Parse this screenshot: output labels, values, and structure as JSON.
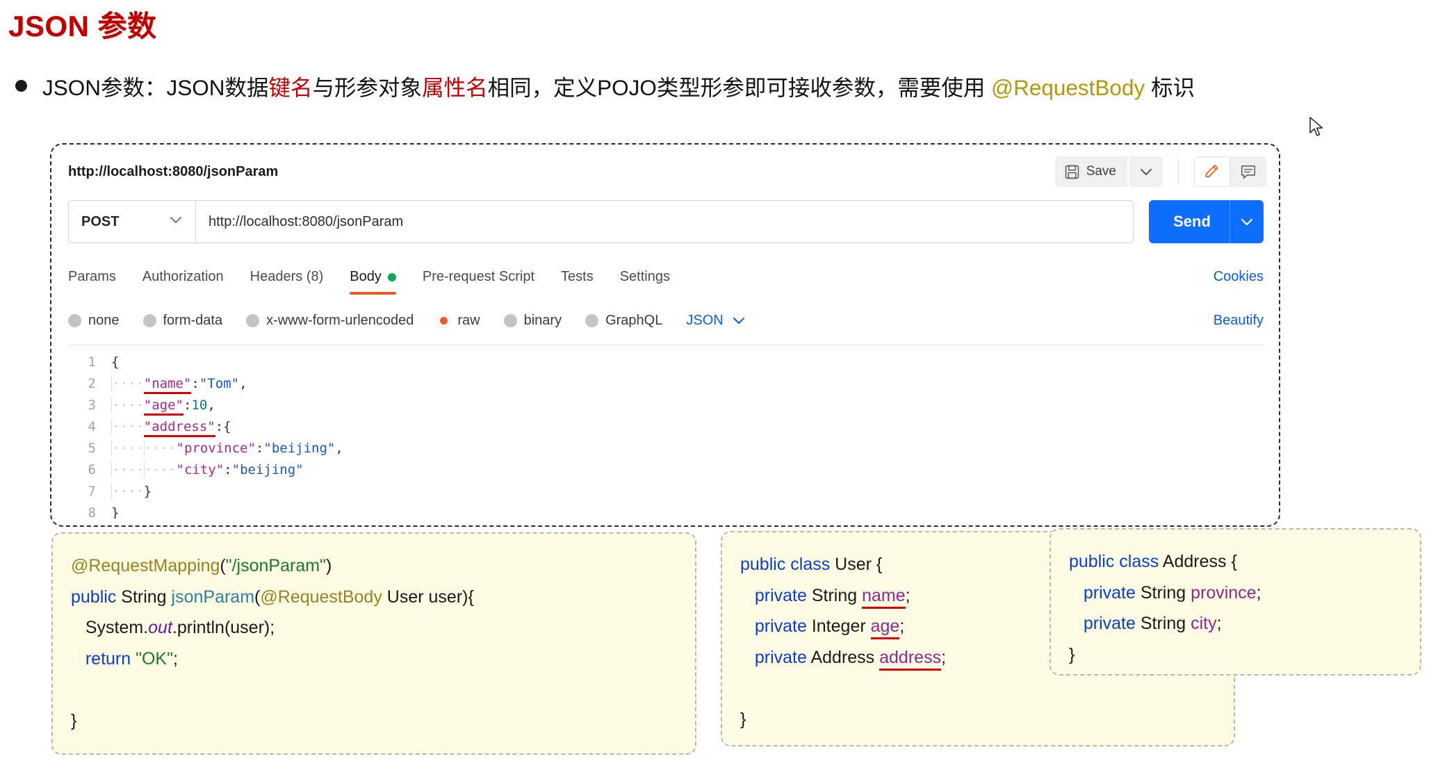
{
  "slide": {
    "title": "JSON 参数",
    "bullet": {
      "seg1": "JSON参数：JSON数据",
      "seg2_red": "键名",
      "seg3": "与形参对象",
      "seg4_red": "属性名",
      "seg5": "相同，定义POJO类型形参即可接收参数，需要使用 ",
      "seg6_gold": "@RequestBody",
      "seg7": " 标识"
    },
    "title_color": "#c00000",
    "highlight_color": "#c00000",
    "annotation_color": "#b8960b"
  },
  "postman": {
    "tab_title": "http://localhost:8080/jsonParam",
    "save_label": "Save",
    "icons": {
      "floppy": "save-icon",
      "caret": "chevron-down-icon",
      "pencil": "edit-pencil-icon",
      "comment": "comment-icon"
    },
    "method": "POST",
    "url": "http://localhost:8080/jsonParam",
    "send_label": "Send",
    "send_color": "#0d6efd",
    "tabs": [
      {
        "label": "Params",
        "active": false,
        "dot": false
      },
      {
        "label": "Authorization",
        "active": false,
        "dot": false
      },
      {
        "label": "Headers (8)",
        "active": false,
        "dot": false
      },
      {
        "label": "Body",
        "active": true,
        "dot": true
      },
      {
        "label": "Pre-request Script",
        "active": false,
        "dot": false
      },
      {
        "label": "Tests",
        "active": false,
        "dot": false
      },
      {
        "label": "Settings",
        "active": false,
        "dot": false
      }
    ],
    "cookies_label": "Cookies",
    "body_types": [
      {
        "label": "none",
        "selected": false
      },
      {
        "label": "form-data",
        "selected": false
      },
      {
        "label": "x-www-form-urlencoded",
        "selected": false
      },
      {
        "label": "raw",
        "selected": true
      },
      {
        "label": "binary",
        "selected": false
      },
      {
        "label": "GraphQL",
        "selected": false
      }
    ],
    "raw_format": "JSON",
    "beautify_label": "Beautify",
    "active_tab_underline_color": "#ef5b25",
    "body_dot_color": "#0ca750",
    "editor": {
      "lines": [
        {
          "n": "1",
          "indent": 0,
          "guides": 0,
          "tokens": [
            {
              "t": "{",
              "c": "pun"
            }
          ]
        },
        {
          "n": "2",
          "indent": 1,
          "guides": 1,
          "tokens": [
            {
              "t": "\"name\"",
              "c": "key",
              "ul": true
            },
            {
              "t": ":",
              "c": "pun"
            },
            {
              "t": "\"Tom\"",
              "c": "str"
            },
            {
              "t": ",",
              "c": "pun"
            }
          ]
        },
        {
          "n": "3",
          "indent": 1,
          "guides": 1,
          "tokens": [
            {
              "t": "\"age\"",
              "c": "key",
              "ul": true
            },
            {
              "t": ":",
              "c": "pun"
            },
            {
              "t": "10",
              "c": "num"
            },
            {
              "t": ",",
              "c": "pun"
            }
          ]
        },
        {
          "n": "4",
          "indent": 1,
          "guides": 1,
          "tokens": [
            {
              "t": "\"address\"",
              "c": "key",
              "ul": true
            },
            {
              "t": ":",
              "c": "pun"
            },
            {
              "t": "{",
              "c": "pun"
            }
          ]
        },
        {
          "n": "5",
          "indent": 2,
          "guides": 2,
          "tokens": [
            {
              "t": "\"province\"",
              "c": "key"
            },
            {
              "t": ":",
              "c": "pun"
            },
            {
              "t": "\"beijing\"",
              "c": "str"
            },
            {
              "t": ",",
              "c": "pun"
            }
          ]
        },
        {
          "n": "6",
          "indent": 2,
          "guides": 2,
          "tokens": [
            {
              "t": "\"city\"",
              "c": "key"
            },
            {
              "t": ":",
              "c": "pun"
            },
            {
              "t": "\"beijing\"",
              "c": "str"
            }
          ]
        },
        {
          "n": "7",
          "indent": 1,
          "guides": 1,
          "tokens": [
            {
              "t": "}",
              "c": "pun"
            }
          ]
        },
        {
          "n": "8",
          "indent": 0,
          "guides": 0,
          "tokens": [
            {
              "t": "}",
              "c": "pun"
            }
          ]
        }
      ]
    }
  },
  "code_cards": {
    "controller": {
      "lines": [
        [
          {
            "t": "@RequestMapping",
            "c": "ann"
          },
          {
            "t": "(",
            "c": "plain"
          },
          {
            "t": "\"/jsonParam\"",
            "c": "str"
          },
          {
            "t": ")",
            "c": "plain"
          }
        ],
        [
          {
            "t": "public",
            "c": "kw"
          },
          {
            "t": " String ",
            "c": "plain"
          },
          {
            "t": "jsonParam",
            "c": "meth"
          },
          {
            "t": "(",
            "c": "plain"
          },
          {
            "t": "@RequestBody",
            "c": "ann"
          },
          {
            "t": " User user){",
            "c": "plain"
          }
        ],
        [
          {
            "t": "   System.",
            "c": "plain"
          },
          {
            "t": "out",
            "c": "stat"
          },
          {
            "t": ".println(user);",
            "c": "plain"
          }
        ],
        [
          {
            "t": "   ",
            "c": "plain"
          },
          {
            "t": "return",
            "c": "kw"
          },
          {
            "t": " ",
            "c": "plain"
          },
          {
            "t": "\"OK\"",
            "c": "str"
          },
          {
            "t": ";",
            "c": "plain"
          }
        ],
        [],
        [
          {
            "t": "}",
            "c": "plain"
          }
        ]
      ]
    },
    "user_class": {
      "lines": [
        [
          {
            "t": "public class",
            "c": "kw"
          },
          {
            "t": " User {",
            "c": "plain"
          }
        ],
        [
          {
            "t": "   ",
            "c": "plain"
          },
          {
            "t": "private",
            "c": "kw"
          },
          {
            "t": " String ",
            "c": "plain"
          },
          {
            "t": "name",
            "c": "field",
            "ul": true
          },
          {
            "t": ";",
            "c": "plain"
          }
        ],
        [
          {
            "t": "   ",
            "c": "plain"
          },
          {
            "t": "private",
            "c": "kw"
          },
          {
            "t": " Integer ",
            "c": "plain"
          },
          {
            "t": "age",
            "c": "field",
            "ul": true
          },
          {
            "t": ";",
            "c": "plain"
          }
        ],
        [
          {
            "t": "   ",
            "c": "plain"
          },
          {
            "t": "private",
            "c": "kw"
          },
          {
            "t": " Address ",
            "c": "plain"
          },
          {
            "t": "address",
            "c": "field",
            "ul": true
          },
          {
            "t": ";",
            "c": "plain"
          }
        ],
        [],
        [
          {
            "t": "}",
            "c": "plain"
          }
        ]
      ]
    },
    "address_class": {
      "lines": [
        [
          {
            "t": "public class",
            "c": "kw"
          },
          {
            "t": " Address {",
            "c": "plain"
          }
        ],
        [
          {
            "t": "   ",
            "c": "plain"
          },
          {
            "t": "private",
            "c": "kw"
          },
          {
            "t": " String ",
            "c": "plain"
          },
          {
            "t": "province",
            "c": "field"
          },
          {
            "t": ";",
            "c": "plain"
          }
        ],
        [
          {
            "t": "   ",
            "c": "plain"
          },
          {
            "t": "private",
            "c": "kw"
          },
          {
            "t": " String ",
            "c": "plain"
          },
          {
            "t": "city",
            "c": "field"
          },
          {
            "t": ";",
            "c": "plain"
          }
        ],
        [
          {
            "t": "}",
            "c": "plain"
          }
        ]
      ]
    }
  }
}
